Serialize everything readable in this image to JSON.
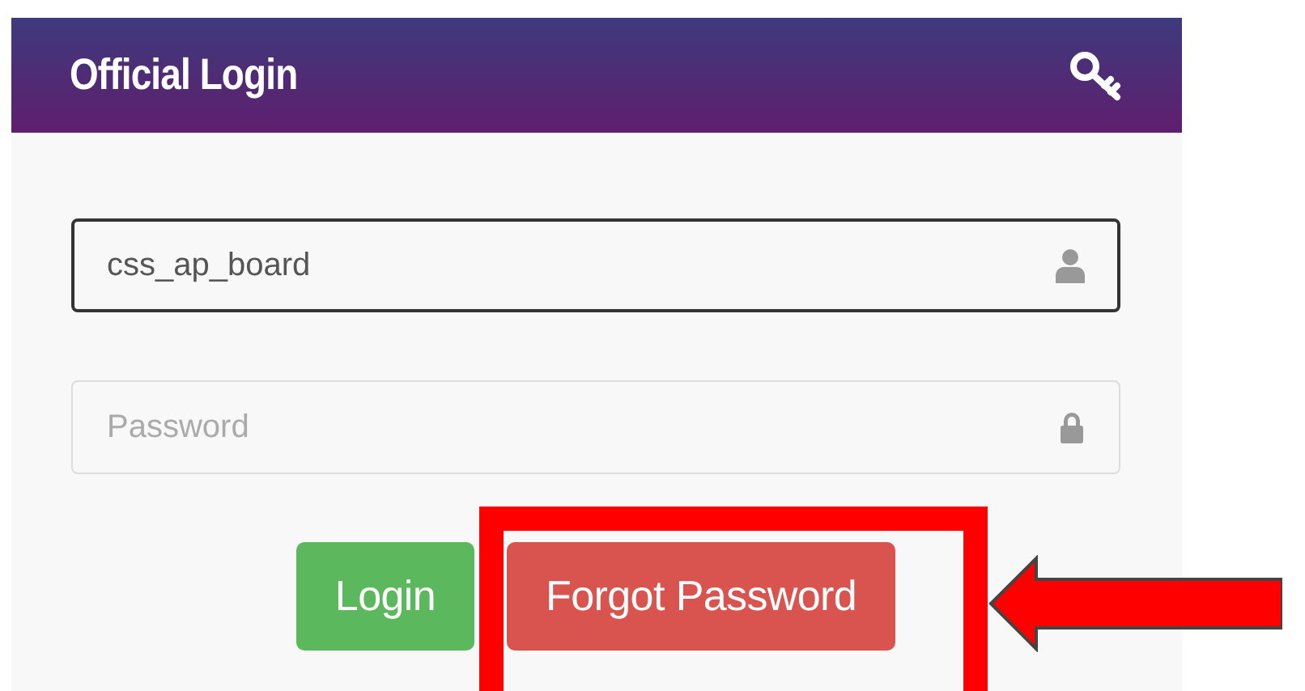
{
  "panel": {
    "title": "Official Login"
  },
  "fields": [
    {
      "kind": "text",
      "value": "css_ap_board",
      "focused": true
    },
    {
      "kind": "password",
      "placeholder": "Password",
      "focused": false
    }
  ],
  "buttons": [
    {
      "label": "Login",
      "kind": "success",
      "highlighted": false
    },
    {
      "label": "Forgot Password",
      "kind": "danger",
      "highlighted": true
    }
  ]
}
